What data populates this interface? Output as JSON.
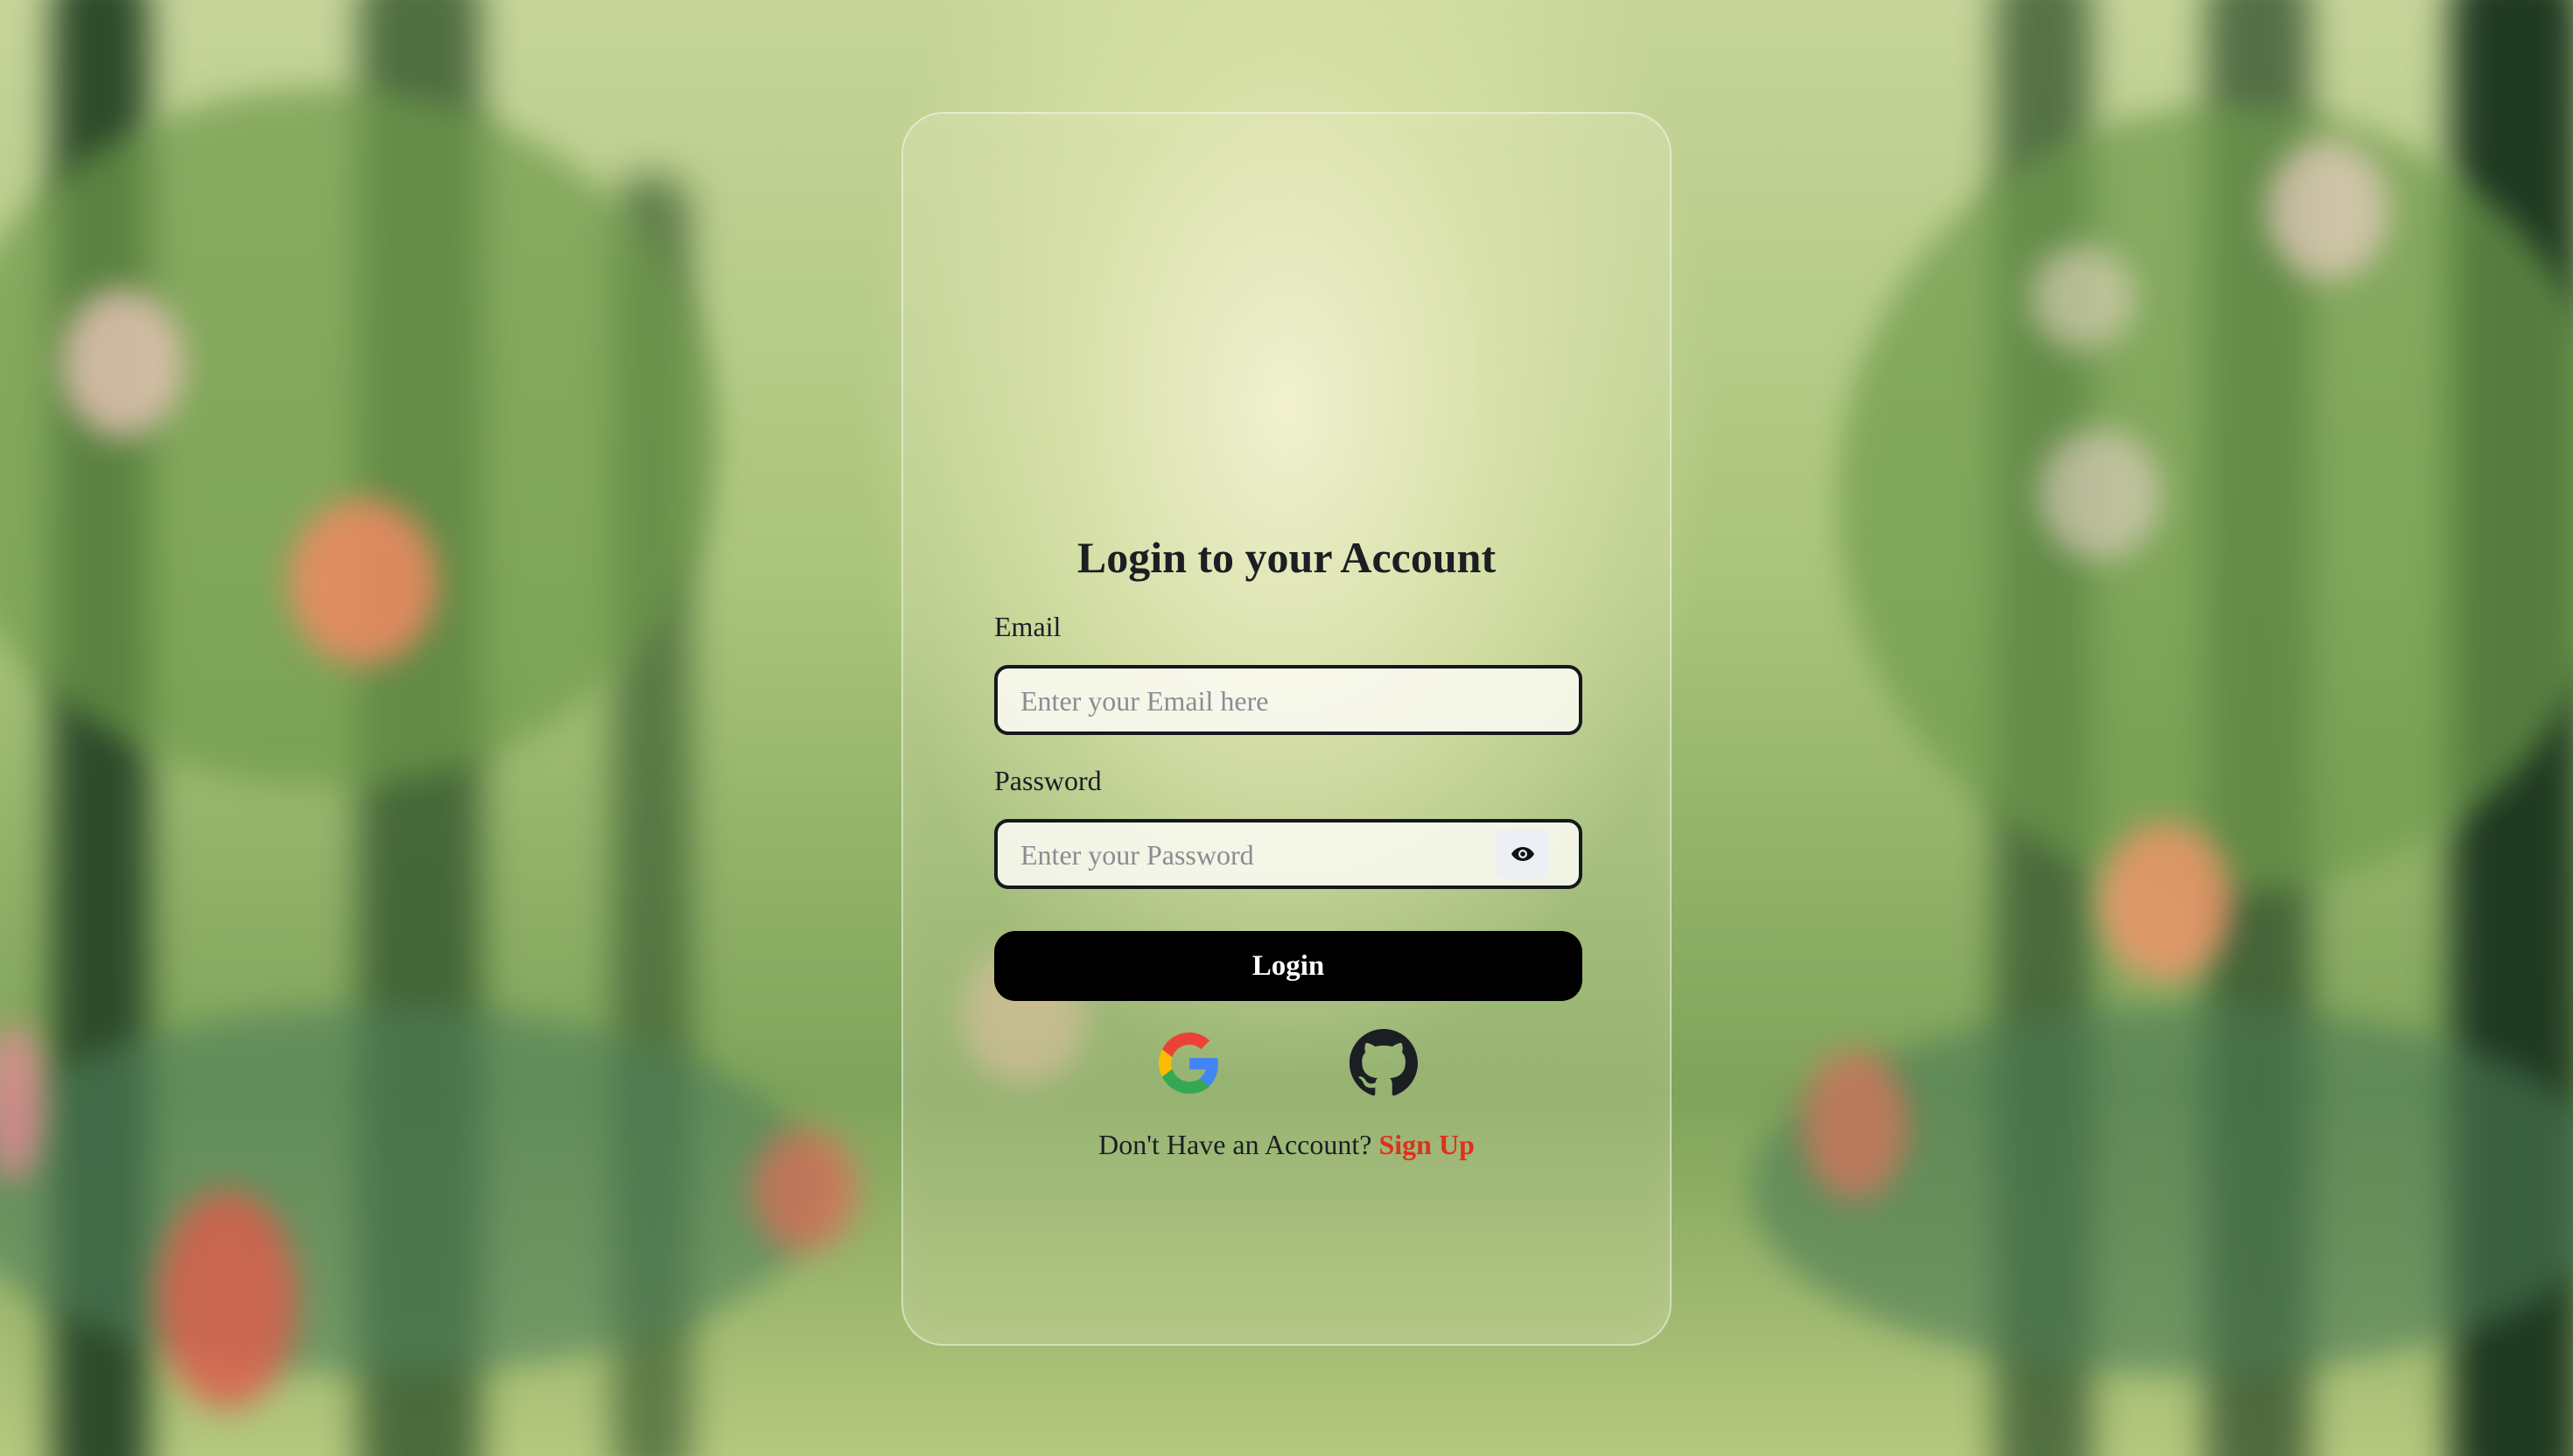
{
  "login": {
    "title": "Login to your Account",
    "email_label": "Email",
    "email_placeholder": "Enter your Email here",
    "password_label": "Password",
    "password_placeholder": "Enter your Password",
    "login_button": "Login",
    "signup_prompt": "Don't Have an Account?",
    "signup_link": "Sign Up"
  },
  "social": [
    "google-icon",
    "github-icon"
  ],
  "icons": {
    "password_toggle": "eye-icon"
  },
  "colors": {
    "accent": "#e0301e",
    "button": "#000000",
    "text": "#1b1e22"
  }
}
